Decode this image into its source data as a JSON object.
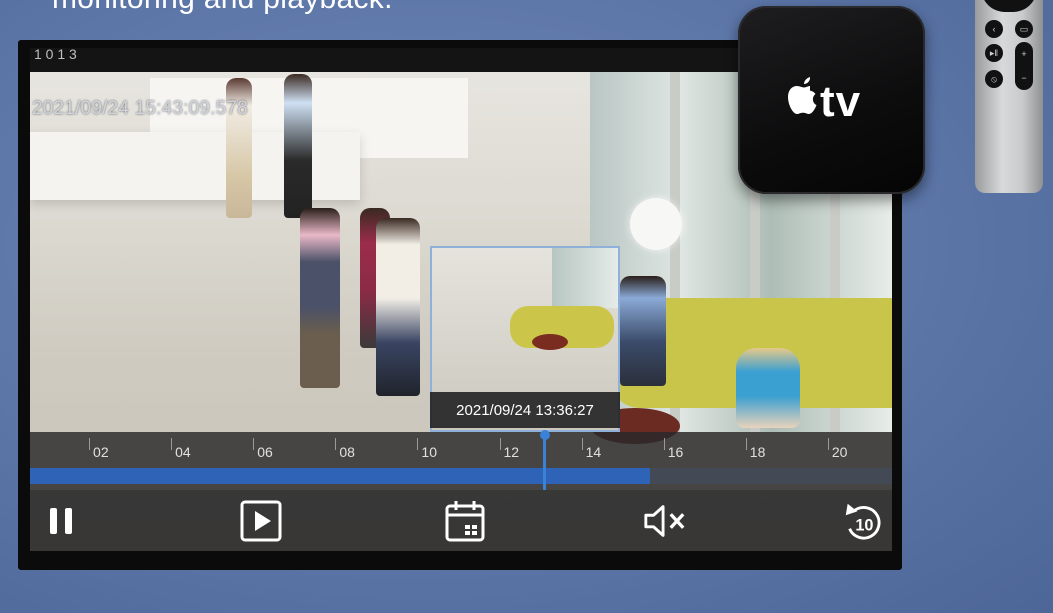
{
  "headline": "monitoring and playback.",
  "screen": {
    "topbar_text": "1 0 1 3",
    "timestamp": "2021/09/24 15:43:09.578"
  },
  "thumbnail": {
    "time_label": "2021/09/24 13:36:27"
  },
  "timeline": {
    "ticks": [
      "02",
      "04",
      "06",
      "08",
      "10",
      "12",
      "14",
      "16",
      "18",
      "20",
      "2"
    ],
    "playhead_hour": 13.5,
    "recorded_until_hour": 16.1,
    "range_start_hour": 1.0,
    "range_end_hour": 22.0
  },
  "controls": {
    "pause": "pause-icon",
    "play": "play-icon",
    "calendar": "calendar-icon",
    "mute": "mute-icon",
    "rewind": "rewind-10-icon",
    "rewind_label": "10"
  },
  "device": {
    "logo_text": "tv"
  },
  "colors": {
    "timeline_fill": "#2f63b7",
    "playhead": "#3a82d8",
    "background": "#5c76a8"
  }
}
